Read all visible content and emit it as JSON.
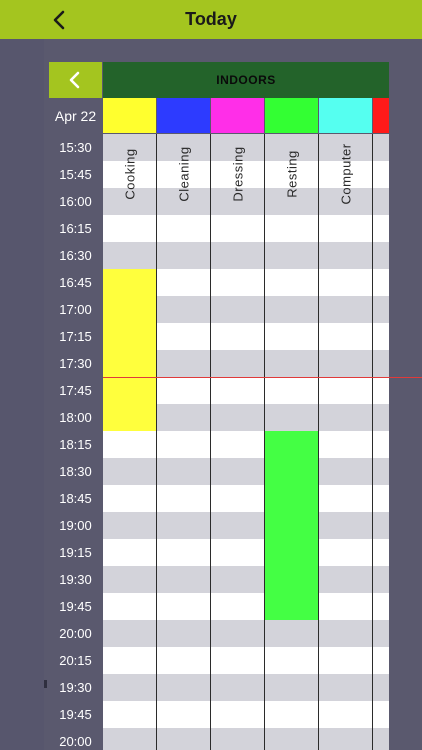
{
  "header": {
    "title": "Today"
  },
  "panel": {
    "group_title": "INDOORS",
    "date_label": "Apr 22",
    "activities": [
      {
        "name": "Cooking",
        "color": "#ffff2e"
      },
      {
        "name": "Cleaning",
        "color": "#2d3bff"
      },
      {
        "name": "Dressing",
        "color": "#ff2ee8"
      },
      {
        "name": "Resting",
        "color": "#33ff33"
      },
      {
        "name": "Computer",
        "color": "#55fff0"
      },
      {
        "name": "",
        "color": "#ff1a1a"
      }
    ],
    "times": [
      "15:30",
      "15:45",
      "16:00",
      "16:15",
      "16:30",
      "16:45",
      "17:00",
      "17:15",
      "17:30",
      "17:45",
      "18:00",
      "18:15",
      "18:30",
      "18:45",
      "19:00",
      "19:15",
      "19:30",
      "19:45",
      "20:00",
      "20:15",
      "19:30",
      "19:45",
      "20:00"
    ],
    "blocks": [
      {
        "activity": "Cooking",
        "start": "16:45",
        "end": "18:15",
        "color": "#ffff3d"
      },
      {
        "activity": "Resting",
        "start": "18:15",
        "end": "20:00",
        "color": "#44ff44"
      }
    ]
  }
}
